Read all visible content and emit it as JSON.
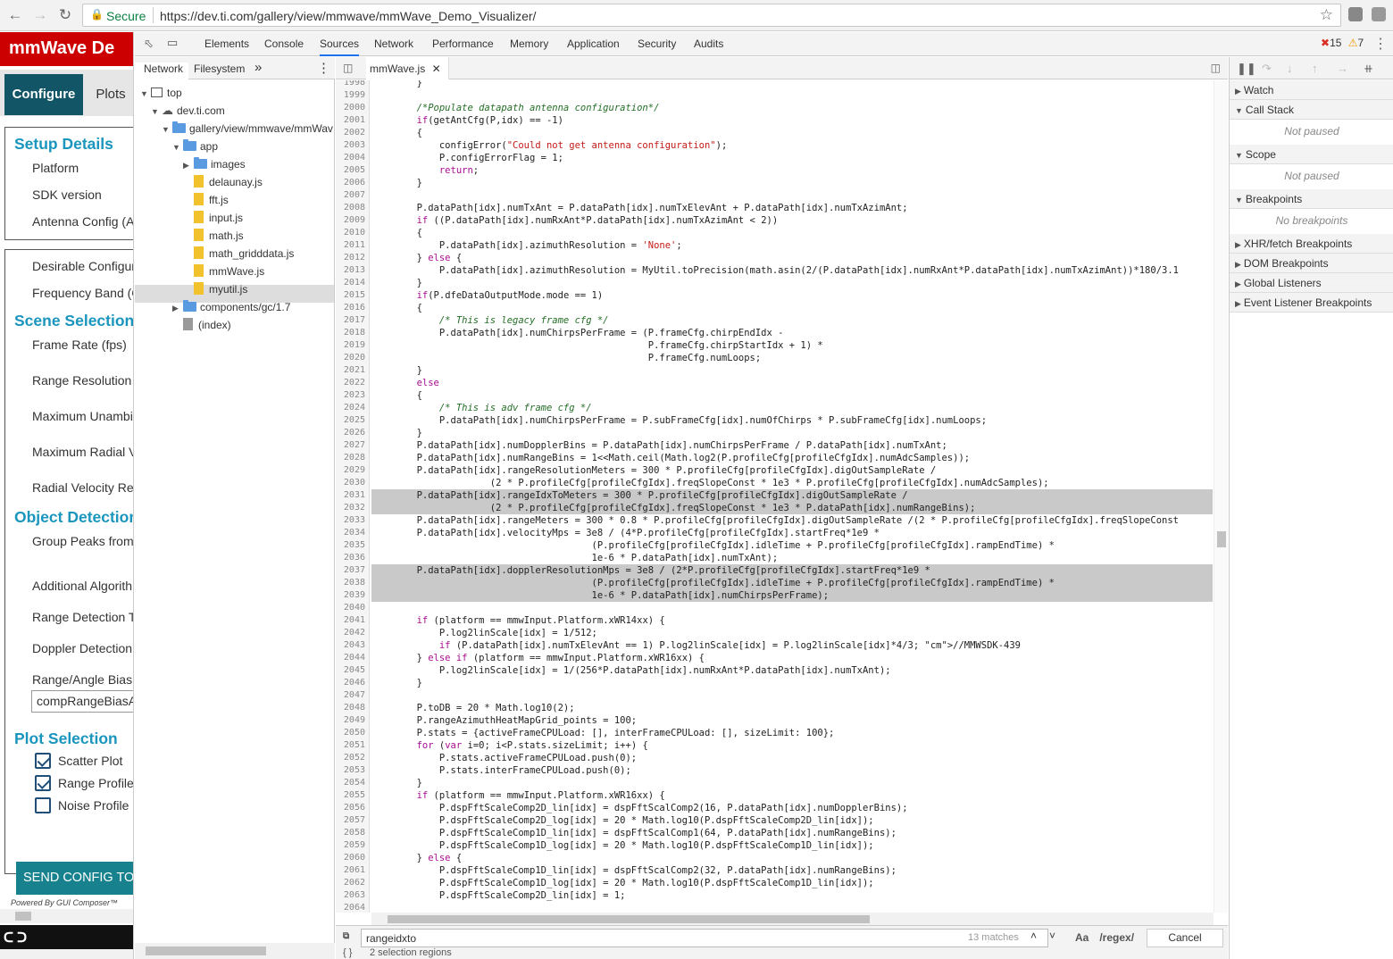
{
  "browser": {
    "secure_label": "Secure",
    "url": "https://dev.ti.com/gallery/view/mmwave/mmWave_Demo_Visualizer/"
  },
  "app": {
    "title": "mmWave De",
    "tabs": {
      "configure": "Configure",
      "plots": "Plots"
    },
    "setup": {
      "heading": "Setup Details",
      "items": [
        "Platform",
        "SDK version",
        "Antenna Config (A"
      ]
    },
    "scene": {
      "pre_items": [
        "Desirable Configur",
        "Frequency Band (G"
      ],
      "heading": "Scene Selection",
      "items": [
        "Frame Rate (fps)",
        "Range Resolution",
        "Maximum Unambi",
        "Maximum Radial V",
        "Radial Velocity Re"
      ]
    },
    "object": {
      "heading": "Object Detection",
      "items": [
        "Group Peaks from",
        "Additional Algorith",
        "Range Detection T",
        "Doppler Detection",
        "Range/Angle Bias"
      ],
      "bias_value": "compRangeBiasA"
    },
    "plot": {
      "heading": "Plot Selection",
      "items": [
        {
          "label": "Scatter Plot",
          "checked": true
        },
        {
          "label": "Range Profile",
          "checked": true
        },
        {
          "label": "Noise Profile",
          "checked": false
        }
      ]
    },
    "send_button": "SEND CONFIG TO",
    "powered_by": "Powered By GUI Composer™",
    "bottom_text": "ᑕ ᑐ"
  },
  "devtools": {
    "tabs": [
      "Elements",
      "Console",
      "Sources",
      "Network",
      "Performance",
      "Memory",
      "Application",
      "Security",
      "Audits"
    ],
    "active_tab": "Sources",
    "errors": "15",
    "warnings": "7",
    "navigator": {
      "tabs": [
        "Network",
        "Filesystem"
      ],
      "more": "»",
      "tree": [
        {
          "label": "top",
          "kind": "top",
          "level": 0
        },
        {
          "label": "dev.ti.com",
          "kind": "cloud",
          "level": 1
        },
        {
          "label": "gallery/view/mmwave/mmWav",
          "kind": "folder",
          "level": 2
        },
        {
          "label": "app",
          "kind": "folder",
          "level": 3
        },
        {
          "label": "images",
          "kind": "folder",
          "level": 4
        },
        {
          "label": "delaunay.js",
          "kind": "file",
          "level": 4
        },
        {
          "label": "fft.js",
          "kind": "file",
          "level": 4
        },
        {
          "label": "input.js",
          "kind": "file",
          "level": 4
        },
        {
          "label": "math.js",
          "kind": "file",
          "level": 4
        },
        {
          "label": "math_gridddata.js",
          "kind": "file",
          "level": 4
        },
        {
          "label": "mmWave.js",
          "kind": "file",
          "level": 4
        },
        {
          "label": "myutil.js",
          "kind": "file",
          "level": 4
        },
        {
          "label": "components/gc/1.7",
          "kind": "folder",
          "level": 3
        },
        {
          "label": "(index)",
          "kind": "gray",
          "level": 3
        }
      ]
    },
    "editor": {
      "file_tab": "mmWave.js",
      "search_value": "rangeidxto",
      "matches": "13 matches",
      "match_case": "Aa",
      "regex": "/regex/",
      "cancel": "Cancel",
      "status": "2 selection regions",
      "status_icon": "{ }",
      "highlight_rows": [
        33,
        34,
        39,
        40,
        41
      ],
      "lines": [
        [
          "1998",
          "        }"
        ],
        [
          "1999",
          ""
        ],
        [
          "2000",
          "        /*Populate datapath antenna configuration*/"
        ],
        [
          "2001",
          "        if(getAntCfg(P,idx) == -1)"
        ],
        [
          "2002",
          "        {"
        ],
        [
          "2003",
          "            configError(\"Could not get antenna configuration\");"
        ],
        [
          "2004",
          "            P.configErrorFlag = 1;"
        ],
        [
          "2005",
          "            return;"
        ],
        [
          "2006",
          "        }"
        ],
        [
          "2007",
          ""
        ],
        [
          "2008",
          "        P.dataPath[idx].numTxAnt = P.dataPath[idx].numTxElevAnt + P.dataPath[idx].numTxAzimAnt;"
        ],
        [
          "2009",
          "        if ((P.dataPath[idx].numRxAnt*P.dataPath[idx].numTxAzimAnt < 2))"
        ],
        [
          "2010",
          "        {"
        ],
        [
          "2011",
          "            P.dataPath[idx].azimuthResolution = 'None';"
        ],
        [
          "2012",
          "        } else {"
        ],
        [
          "2013",
          "            P.dataPath[idx].azimuthResolution = MyUtil.toPrecision(math.asin(2/(P.dataPath[idx].numRxAnt*P.dataPath[idx].numTxAzimAnt))*180/3.1"
        ],
        [
          "2014",
          "        }"
        ],
        [
          "2015",
          "        if(P.dfeDataOutputMode.mode == 1)"
        ],
        [
          "2016",
          "        {"
        ],
        [
          "2017",
          "            /* This is legacy frame cfg */"
        ],
        [
          "2018",
          "            P.dataPath[idx].numChirpsPerFrame = (P.frameCfg.chirpEndIdx -"
        ],
        [
          "2019",
          "                                                 P.frameCfg.chirpStartIdx + 1) *"
        ],
        [
          "2020",
          "                                                 P.frameCfg.numLoops;"
        ],
        [
          "2021",
          "        }"
        ],
        [
          "2022",
          "        else"
        ],
        [
          "2023",
          "        {"
        ],
        [
          "2024",
          "            /* This is adv frame cfg */"
        ],
        [
          "2025",
          "            P.dataPath[idx].numChirpsPerFrame = P.subFrameCfg[idx].numOfChirps * P.subFrameCfg[idx].numLoops;"
        ],
        [
          "2026",
          "        }"
        ],
        [
          "2027",
          "        P.dataPath[idx].numDopplerBins = P.dataPath[idx].numChirpsPerFrame / P.dataPath[idx].numTxAnt;"
        ],
        [
          "2028",
          "        P.dataPath[idx].numRangeBins = 1<<Math.ceil(Math.log2(P.profileCfg[profileCfgIdx].numAdcSamples));"
        ],
        [
          "2029",
          "        P.dataPath[idx].rangeResolutionMeters = 300 * P.profileCfg[profileCfgIdx].digOutSampleRate /"
        ],
        [
          "2030",
          "                     (2 * P.profileCfg[profileCfgIdx].freqSlopeConst * 1e3 * P.profileCfg[profileCfgIdx].numAdcSamples);"
        ],
        [
          "2031",
          "        P.dataPath[idx].rangeIdxToMeters = 300 * P.profileCfg[profileCfgIdx].digOutSampleRate /"
        ],
        [
          "2032",
          "                     (2 * P.profileCfg[profileCfgIdx].freqSlopeConst * 1e3 * P.dataPath[idx].numRangeBins);"
        ],
        [
          "2033",
          "        P.dataPath[idx].rangeMeters = 300 * 0.8 * P.profileCfg[profileCfgIdx].digOutSampleRate /(2 * P.profileCfg[profileCfgIdx].freqSlopeConst"
        ],
        [
          "2034",
          "        P.dataPath[idx].velocityMps = 3e8 / (4*P.profileCfg[profileCfgIdx].startFreq*1e9 *"
        ],
        [
          "2035",
          "                                       (P.profileCfg[profileCfgIdx].idleTime + P.profileCfg[profileCfgIdx].rampEndTime) *"
        ],
        [
          "2036",
          "                                       1e-6 * P.dataPath[idx].numTxAnt);"
        ],
        [
          "2037",
          "        P.dataPath[idx].dopplerResolutionMps = 3e8 / (2*P.profileCfg[profileCfgIdx].startFreq*1e9 *"
        ],
        [
          "2038",
          "                                       (P.profileCfg[profileCfgIdx].idleTime + P.profileCfg[profileCfgIdx].rampEndTime) *"
        ],
        [
          "2039",
          "                                       1e-6 * P.dataPath[idx].numChirpsPerFrame);"
        ],
        [
          "2040",
          ""
        ],
        [
          "2041",
          "        if (platform == mmwInput.Platform.xWR14xx) {"
        ],
        [
          "2042",
          "            P.log2linScale[idx] = 1/512;"
        ],
        [
          "2043",
          "            if (P.dataPath[idx].numTxElevAnt == 1) P.log2linScale[idx] = P.log2linScale[idx]*4/3; //MMWSDK-439"
        ],
        [
          "2044",
          "        } else if (platform == mmwInput.Platform.xWR16xx) {"
        ],
        [
          "2045",
          "            P.log2linScale[idx] = 1/(256*P.dataPath[idx].numRxAnt*P.dataPath[idx].numTxAnt);"
        ],
        [
          "2046",
          "        }"
        ],
        [
          "2047",
          ""
        ],
        [
          "2048",
          "        P.toDB = 20 * Math.log10(2);"
        ],
        [
          "2049",
          "        P.rangeAzimuthHeatMapGrid_points = 100;"
        ],
        [
          "2050",
          "        P.stats = {activeFrameCPULoad: [], interFrameCPULoad: [], sizeLimit: 100};"
        ],
        [
          "2051",
          "        for (var i=0; i<P.stats.sizeLimit; i++) {"
        ],
        [
          "2052",
          "            P.stats.activeFrameCPULoad.push(0);"
        ],
        [
          "2053",
          "            P.stats.interFrameCPULoad.push(0);"
        ],
        [
          "2054",
          "        }"
        ],
        [
          "2055",
          "        if (platform == mmwInput.Platform.xWR16xx) {"
        ],
        [
          "2056",
          "            P.dspFftScaleComp2D_lin[idx] = dspFftScalComp2(16, P.dataPath[idx].numDopplerBins);"
        ],
        [
          "2057",
          "            P.dspFftScaleComp2D_log[idx] = 20 * Math.log10(P.dspFftScaleComp2D_lin[idx]);"
        ],
        [
          "2058",
          "            P.dspFftScaleComp1D_lin[idx] = dspFftScalComp1(64, P.dataPath[idx].numRangeBins);"
        ],
        [
          "2059",
          "            P.dspFftScaleComp1D_log[idx] = 20 * Math.log10(P.dspFftScaleComp1D_lin[idx]);"
        ],
        [
          "2060",
          "        } else {"
        ],
        [
          "2061",
          "            P.dspFftScaleComp1D_lin[idx] = dspFftScalComp2(32, P.dataPath[idx].numRangeBins);"
        ],
        [
          "2062",
          "            P.dspFftScaleComp1D_log[idx] = 20 * Math.log10(P.dspFftScaleComp1D_lin[idx]);"
        ],
        [
          "2063",
          "            P.dspFftScaleComp2D_lin[idx] = 1;"
        ],
        [
          "2064",
          ""
        ]
      ]
    },
    "debugger": {
      "panes": [
        {
          "label": "Watch",
          "open": false
        },
        {
          "label": "Call Stack",
          "open": true,
          "empty": "Not paused"
        },
        {
          "label": "Scope",
          "open": true,
          "empty": "Not paused"
        },
        {
          "label": "Breakpoints",
          "open": true,
          "empty": "No breakpoints"
        },
        {
          "label": "XHR/fetch Breakpoints",
          "open": false
        },
        {
          "label": "DOM Breakpoints",
          "open": false
        },
        {
          "label": "Global Listeners",
          "open": false
        },
        {
          "label": "Event Listener Breakpoints",
          "open": false
        }
      ]
    }
  }
}
